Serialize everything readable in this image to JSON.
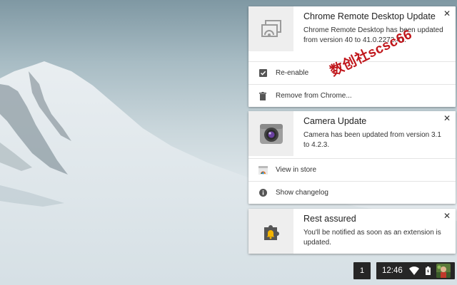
{
  "notifications": [
    {
      "title": "Chrome Remote Desktop Update",
      "message": "Chrome Remote Desktop has been updated from version 40 to 41.0.2272.41.",
      "icon": "remote-desktop-icon",
      "actions": [
        {
          "label": "Re-enable",
          "icon": "checkbox-icon"
        },
        {
          "label": "Remove from Chrome...",
          "icon": "trash-icon"
        }
      ]
    },
    {
      "title": "Camera Update",
      "message": "Camera has been updated from version 3.1 to 4.2.3.",
      "icon": "camera-icon",
      "actions": [
        {
          "label": "View in store",
          "icon": "webstore-icon"
        },
        {
          "label": "Show changelog",
          "icon": "info-icon"
        }
      ]
    },
    {
      "title": "Rest assured",
      "message": "You'll be notified as soon as an extension is updated.",
      "icon": "extension-bell-icon",
      "actions": []
    }
  ],
  "close_glyph": "✕",
  "watermark": "数创社scsc66",
  "shelf": {
    "notification_count": "1",
    "time": "12:46"
  },
  "colors": {
    "card_bg": "#ffffff",
    "icon_bg": "#eeeeee",
    "tray_bg": "#262626",
    "watermark": "#c0161b"
  }
}
